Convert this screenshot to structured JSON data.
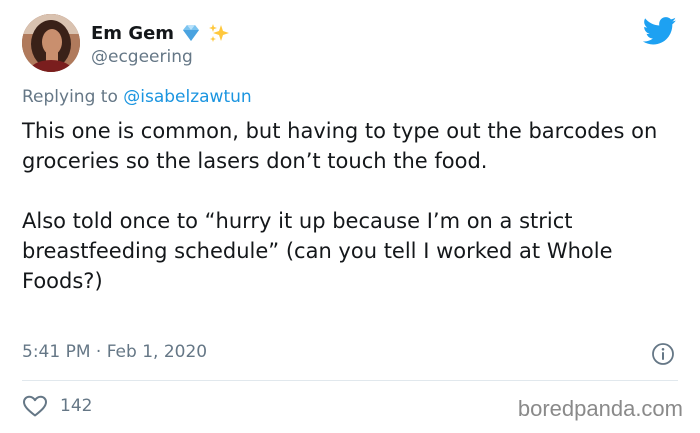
{
  "author": {
    "display_name": "Em Gem",
    "handle": "@ecgeering",
    "name_emojis": [
      "gem-emoji",
      "sparkles-emoji"
    ]
  },
  "reply": {
    "prefix": "Replying to ",
    "target": "@isabelzawtun"
  },
  "tweet": {
    "paragraph_1": "This one is common, but having to type out the barcodes on groceries so the lasers don’t touch the food.",
    "paragraph_2": "Also told once to “hurry it up because I’m on a strict breastfeeding schedule” (can you tell I worked at Whole Foods?)",
    "timestamp": "5:41 PM · Feb 1, 2020",
    "like_count": "142"
  },
  "watermark": "boredpanda.com",
  "icons": {
    "brand": "twitter-bird-icon",
    "info": "info-icon",
    "like": "heart-icon"
  },
  "colors": {
    "twitter_blue": "#1da1f2",
    "link_blue": "#1b95e0",
    "secondary_text": "#657786",
    "primary_text": "#14171a",
    "divider": "#e1e8ed"
  }
}
